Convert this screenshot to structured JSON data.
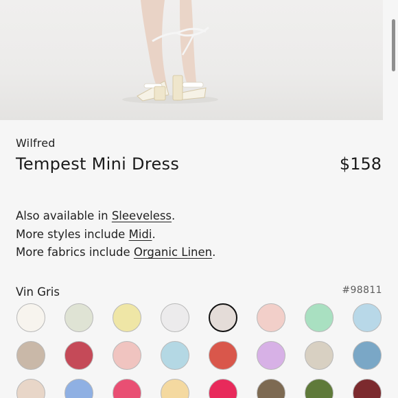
{
  "product": {
    "brand": "Wilfred",
    "name": "Tempest Mini Dress",
    "price": "$158"
  },
  "availability": {
    "line1_prefix": "Also available in ",
    "line1_link": "Sleeveless",
    "line1_suffix": ".",
    "line2_prefix": "More styles include ",
    "line2_link": "Midi",
    "line2_suffix": ".",
    "line3_prefix": "More fabrics include ",
    "line3_link": "Organic Linen",
    "line3_suffix": "."
  },
  "color": {
    "selected_name": "Vin Gris",
    "sku": "#98811"
  },
  "hero_image": {
    "icon": "product-photo-legs-sandals"
  },
  "swatch_colors": [
    [
      "#f7f4ee",
      "#dfe3d4",
      "#efe6a6",
      "#ecebec",
      "#e4dcd8",
      "#f2cfc9",
      "#a9e0c1",
      "#b8d8e8"
    ],
    [
      "#c9b8a8",
      "#c54a58",
      "#f0c4c0",
      "#b4d8e4",
      "#d9574b",
      "#d7b1e6",
      "#d8d0c2",
      "#7aa7c6"
    ],
    [
      "#e8d6c8",
      "#8fb0e3",
      "#e94f73",
      "#f4d9a0",
      "#e82a5b",
      "#7d6a52",
      "#5f7a3a",
      "#7c2a2e"
    ]
  ]
}
